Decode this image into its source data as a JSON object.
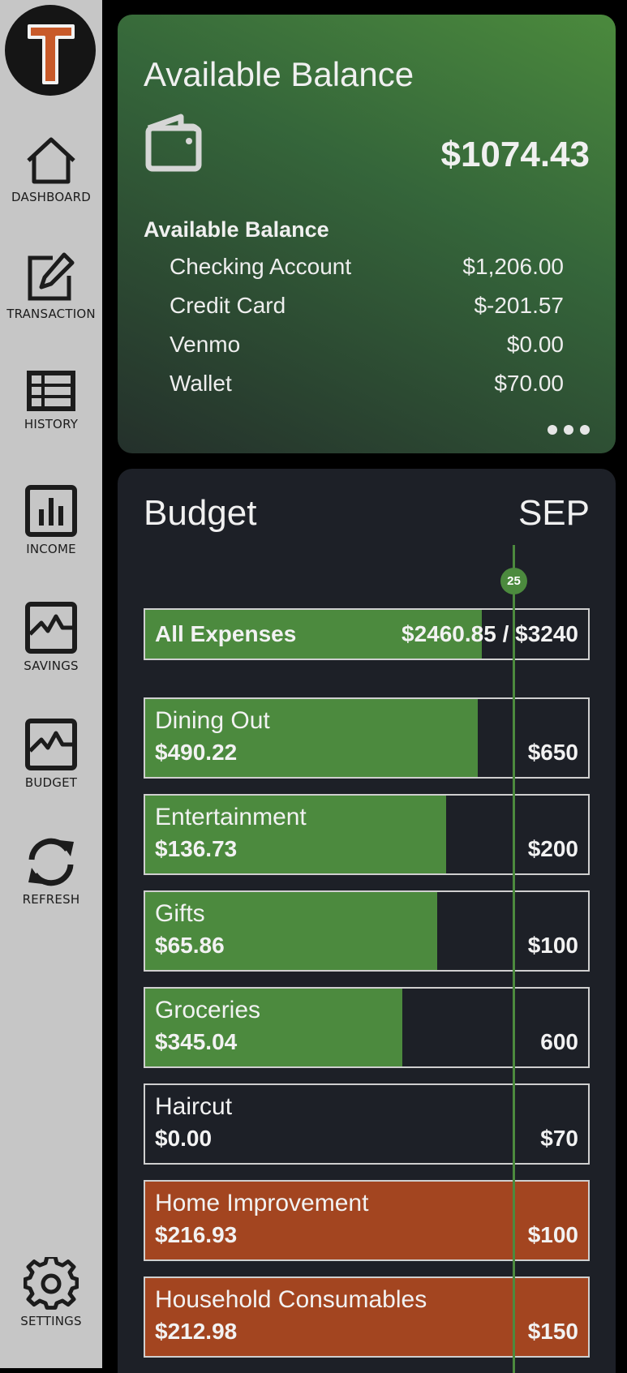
{
  "sidebar": {
    "items": [
      {
        "label": "DASHBOARD"
      },
      {
        "label": "TRANSACTION"
      },
      {
        "label": "HISTORY"
      },
      {
        "label": "INCOME"
      },
      {
        "label": "SAVINGS"
      },
      {
        "label": "BUDGET"
      },
      {
        "label": "REFRESH"
      },
      {
        "label": "SETTINGS"
      }
    ]
  },
  "balance": {
    "title": "Available Balance",
    "total": "$1074.43",
    "subtitle": "Available Balance",
    "accounts": [
      {
        "name": "Checking Account",
        "amount": "$1,206.00"
      },
      {
        "name": "Credit Card",
        "amount": "$-201.57"
      },
      {
        "name": "Venmo",
        "amount": "$0.00"
      },
      {
        "name": "Wallet",
        "amount": "$70.00"
      }
    ]
  },
  "budget": {
    "title": "Budget",
    "month": "SEP",
    "day_marker": "25",
    "all_expenses": {
      "label": "All Expenses",
      "amount": "$2460.85 / $3240",
      "progress": 0.76
    },
    "categories": [
      {
        "name": "Dining Out",
        "spent": "$490.22",
        "limit": "$650",
        "progress": 0.75,
        "status": "under"
      },
      {
        "name": "Entertainment",
        "spent": "$136.73",
        "limit": "$200",
        "progress": 0.68,
        "status": "under"
      },
      {
        "name": "Gifts",
        "spent": "$65.86",
        "limit": "$100",
        "progress": 0.66,
        "status": "under"
      },
      {
        "name": "Groceries",
        "spent": "$345.04",
        "limit": "600",
        "progress": 0.58,
        "status": "under"
      },
      {
        "name": "Haircut",
        "spent": "$0.00",
        "limit": "$70",
        "progress": 0,
        "status": "under"
      },
      {
        "name": "Home Improvement",
        "spent": "$216.93",
        "limit": "$100",
        "progress": 1,
        "status": "over"
      },
      {
        "name": "Household Consumables",
        "spent": "$212.98",
        "limit": "$150",
        "progress": 1,
        "status": "over"
      }
    ]
  },
  "colors": {
    "sidebar_bg": "#c6c6c6",
    "accent_green": "#4c8a3e",
    "over_budget": "#a34520",
    "card_dark": "#1d2027",
    "logo_orange": "#c85a2a"
  }
}
